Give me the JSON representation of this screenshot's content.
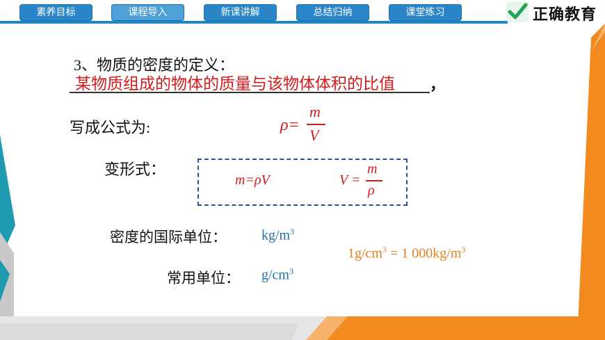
{
  "nav": {
    "items": [
      {
        "label": "素养目标"
      },
      {
        "label": "课程导入"
      },
      {
        "label": "新课讲解"
      },
      {
        "label": "总结归纳"
      },
      {
        "label": "课堂练习"
      }
    ],
    "active_index": 1
  },
  "logo": {
    "brand": "正确教育",
    "icon": "check-mark-icon"
  },
  "colors": {
    "nav_blue": "#2a86c8",
    "accent_orange": "#f28a1f",
    "accent_teal": "#1f9bb0",
    "text_red": "#d21b1b",
    "text_blue": "#1d6fa5",
    "text_orange": "#e6821e"
  },
  "slide": {
    "heading": "3、物质的密度的定义：",
    "definition": "某物质组成的物体的质量与该物体体积的比值",
    "definition_tail": "，",
    "formula_label": "写成公式为:",
    "formula": {
      "lhs": "ρ=",
      "numerator": "m",
      "denominator": "V"
    },
    "variant_label": "变形式：",
    "variant1": "m=ρV",
    "variant2": {
      "lhs": "V =",
      "numerator": "m",
      "denominator": "ρ"
    },
    "si_unit_label": "密度的国际单位：",
    "si_unit": {
      "base": "kg/m",
      "exp": "3"
    },
    "common_unit_label": "常用单位：",
    "common_unit": {
      "base": "g/cm",
      "exp": "3"
    },
    "conversion": {
      "left_base": "1g/cm",
      "left_exp": "3",
      "middle": " = 1 000kg/m",
      "right_exp": "3"
    }
  }
}
